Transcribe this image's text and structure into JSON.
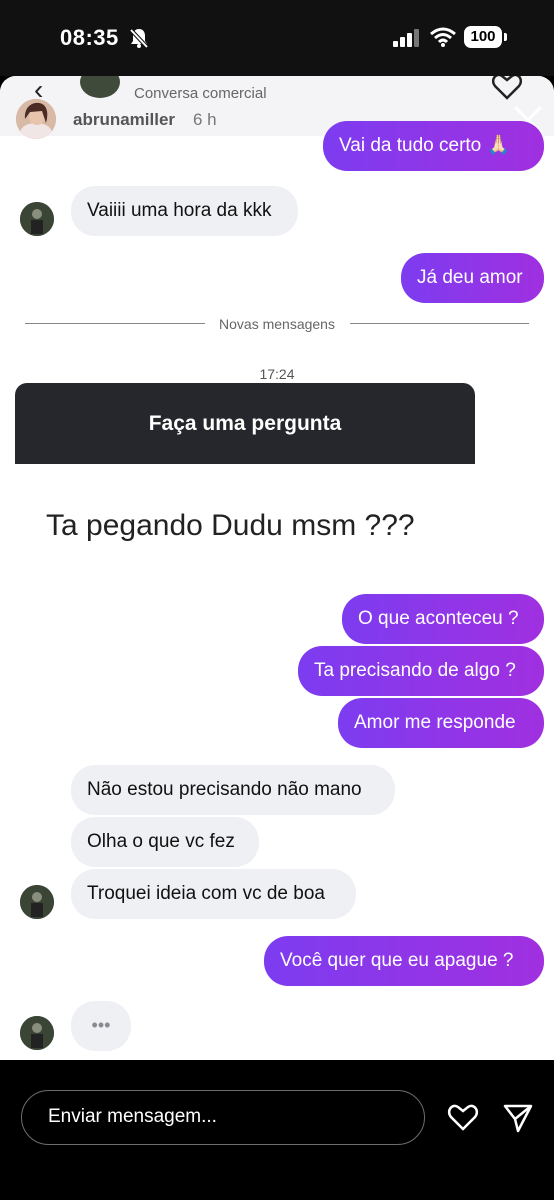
{
  "status": {
    "time": "08:35",
    "battery": "100"
  },
  "header": {
    "chat_subtitle": "Conversa comercial",
    "story_user": "abrunamiller",
    "story_time": "6 h",
    "more": "..."
  },
  "messages": {
    "m1": "Vai da tudo certo 🙏🏻",
    "m2": "Vaiiii uma hora da kkk",
    "m3": "Já deu amor",
    "divider": "Novas mensagens",
    "timestamp": "17:24",
    "question_title": "Faça uma pergunta",
    "question_text": "Ta pegando Dudu msm ???",
    "m4": "O que aconteceu ?",
    "m5": "Ta precisando de algo ?",
    "m6": "Amor me responde",
    "m7": "Não estou precisando não mano",
    "m8": "Olha o que vc fez",
    "m9": "Troquei ideia com vc de boa",
    "m10": "Você quer que eu apague ?",
    "typing": "•••"
  },
  "composer": {
    "placeholder": "Enviar mensagem..."
  },
  "colors": {
    "outgoing_start": "#7d3cf0",
    "outgoing_end": "#a030e0",
    "incoming": "#eff0f4"
  }
}
